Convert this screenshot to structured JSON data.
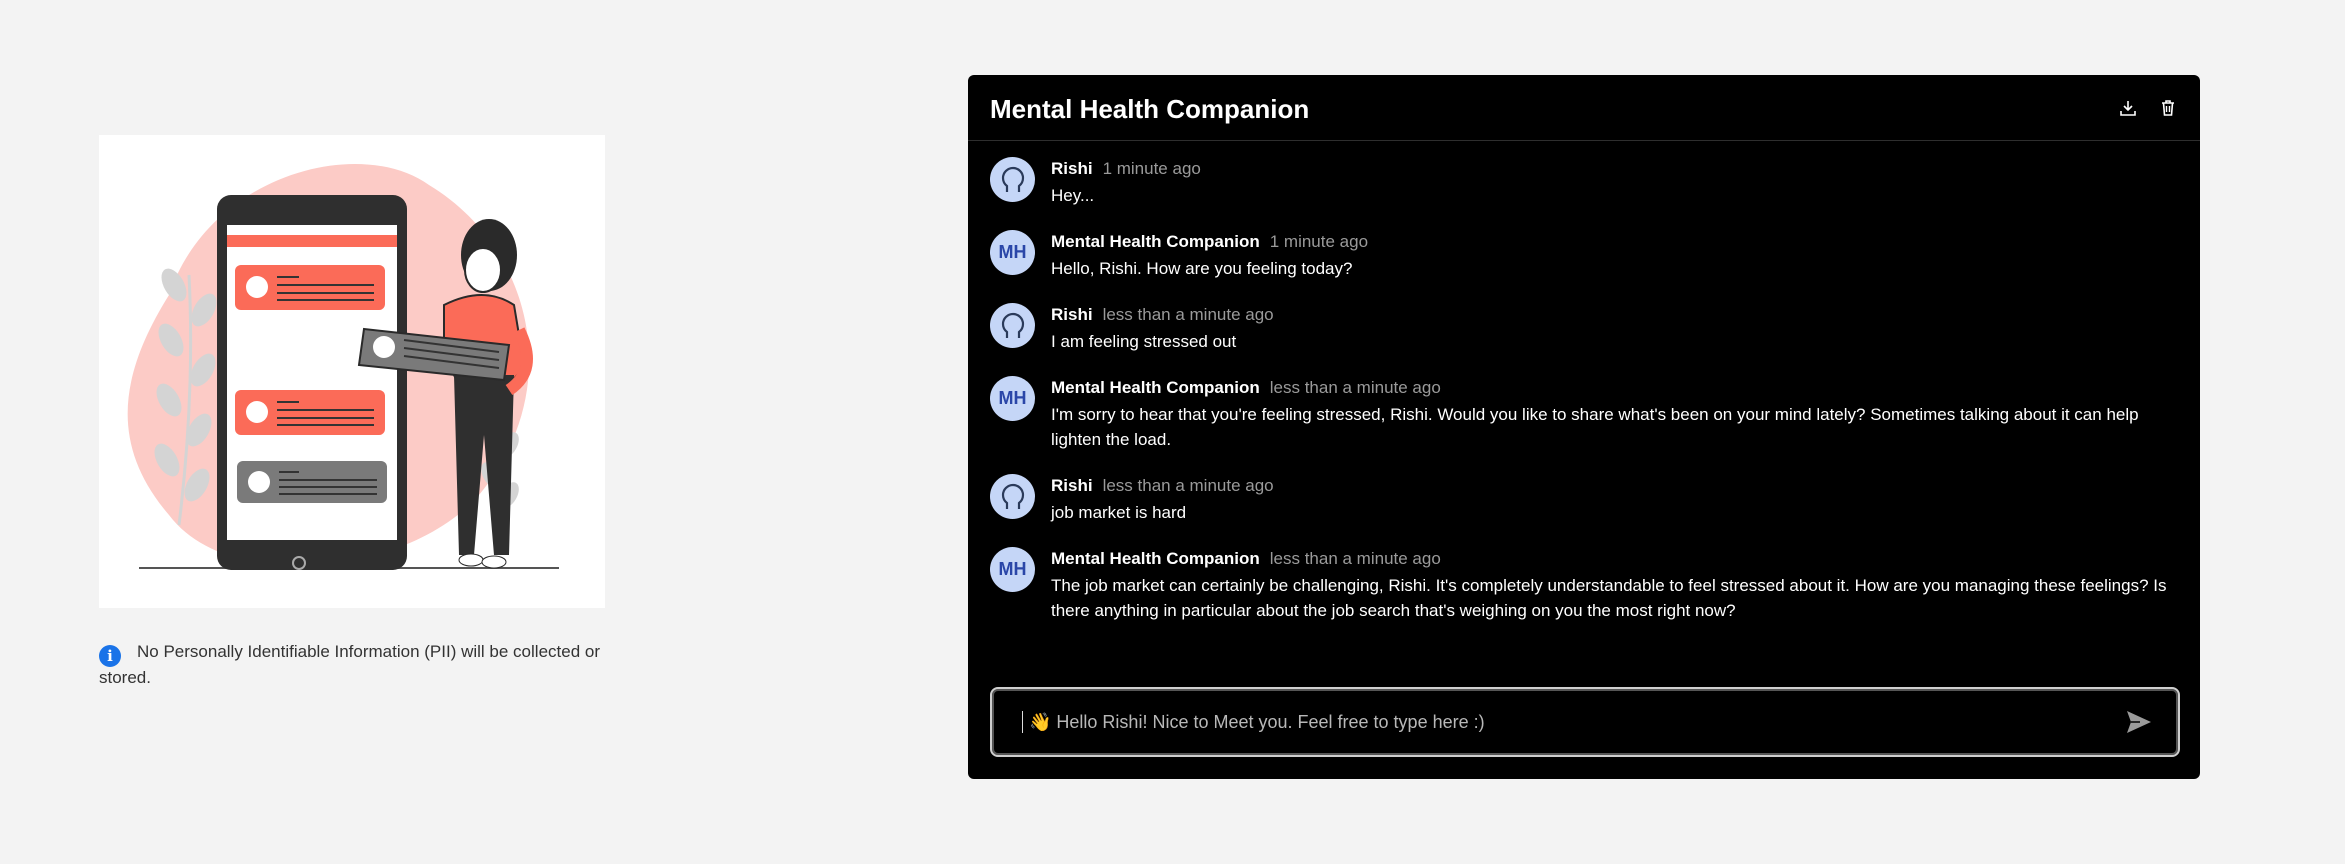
{
  "pii_note": "No Personally Identifiable Information (PII) will be collected or stored.",
  "chat": {
    "title": "Mental Health Companion",
    "actions": {
      "download_icon": "download-icon",
      "delete_icon": "trash-icon"
    },
    "messages": [
      {
        "author": "Rishi",
        "time": "1 minute ago",
        "text": "Hey...",
        "avatar": "user-avatar-icon"
      },
      {
        "author": "Mental Health Companion",
        "time": "1 minute ago",
        "text": "Hello, Rishi. How are you feeling today?",
        "avatar_initials": "MH"
      },
      {
        "author": "Rishi",
        "time": "less than a minute ago",
        "text": "I am feeling stressed out",
        "avatar": "user-avatar-icon"
      },
      {
        "author": "Mental Health Companion",
        "time": "less than a minute ago",
        "text": "I'm sorry to hear that you're feeling stressed, Rishi. Would you like to share what's been on your mind lately? Sometimes talking about it can help lighten the load.",
        "avatar_initials": "MH"
      },
      {
        "author": "Rishi",
        "time": "less than a minute ago",
        "text": "job market is hard",
        "avatar": "user-avatar-icon"
      },
      {
        "author": "Mental Health Companion",
        "time": "less than a minute ago",
        "text": "The job market can certainly be challenging, Rishi. It's completely understandable to feel stressed about it. How are you managing these feelings? Is there anything in particular about the job search that's weighing on you the most right now?",
        "avatar_initials": "MH"
      }
    ],
    "composer": {
      "placeholder": "👋 Hello Rishi! Nice to Meet you. Feel free to type here :)",
      "send_icon": "send-icon"
    }
  },
  "colors": {
    "background": "#f3f3f3",
    "chat_bg": "#000000",
    "avatar_bg": "#c5d6f7",
    "avatar_fg": "#2a46a8",
    "illustration_accent": "#fb6b58",
    "illustration_blob": "#fccbc6",
    "info_blue": "#1a73e8"
  }
}
